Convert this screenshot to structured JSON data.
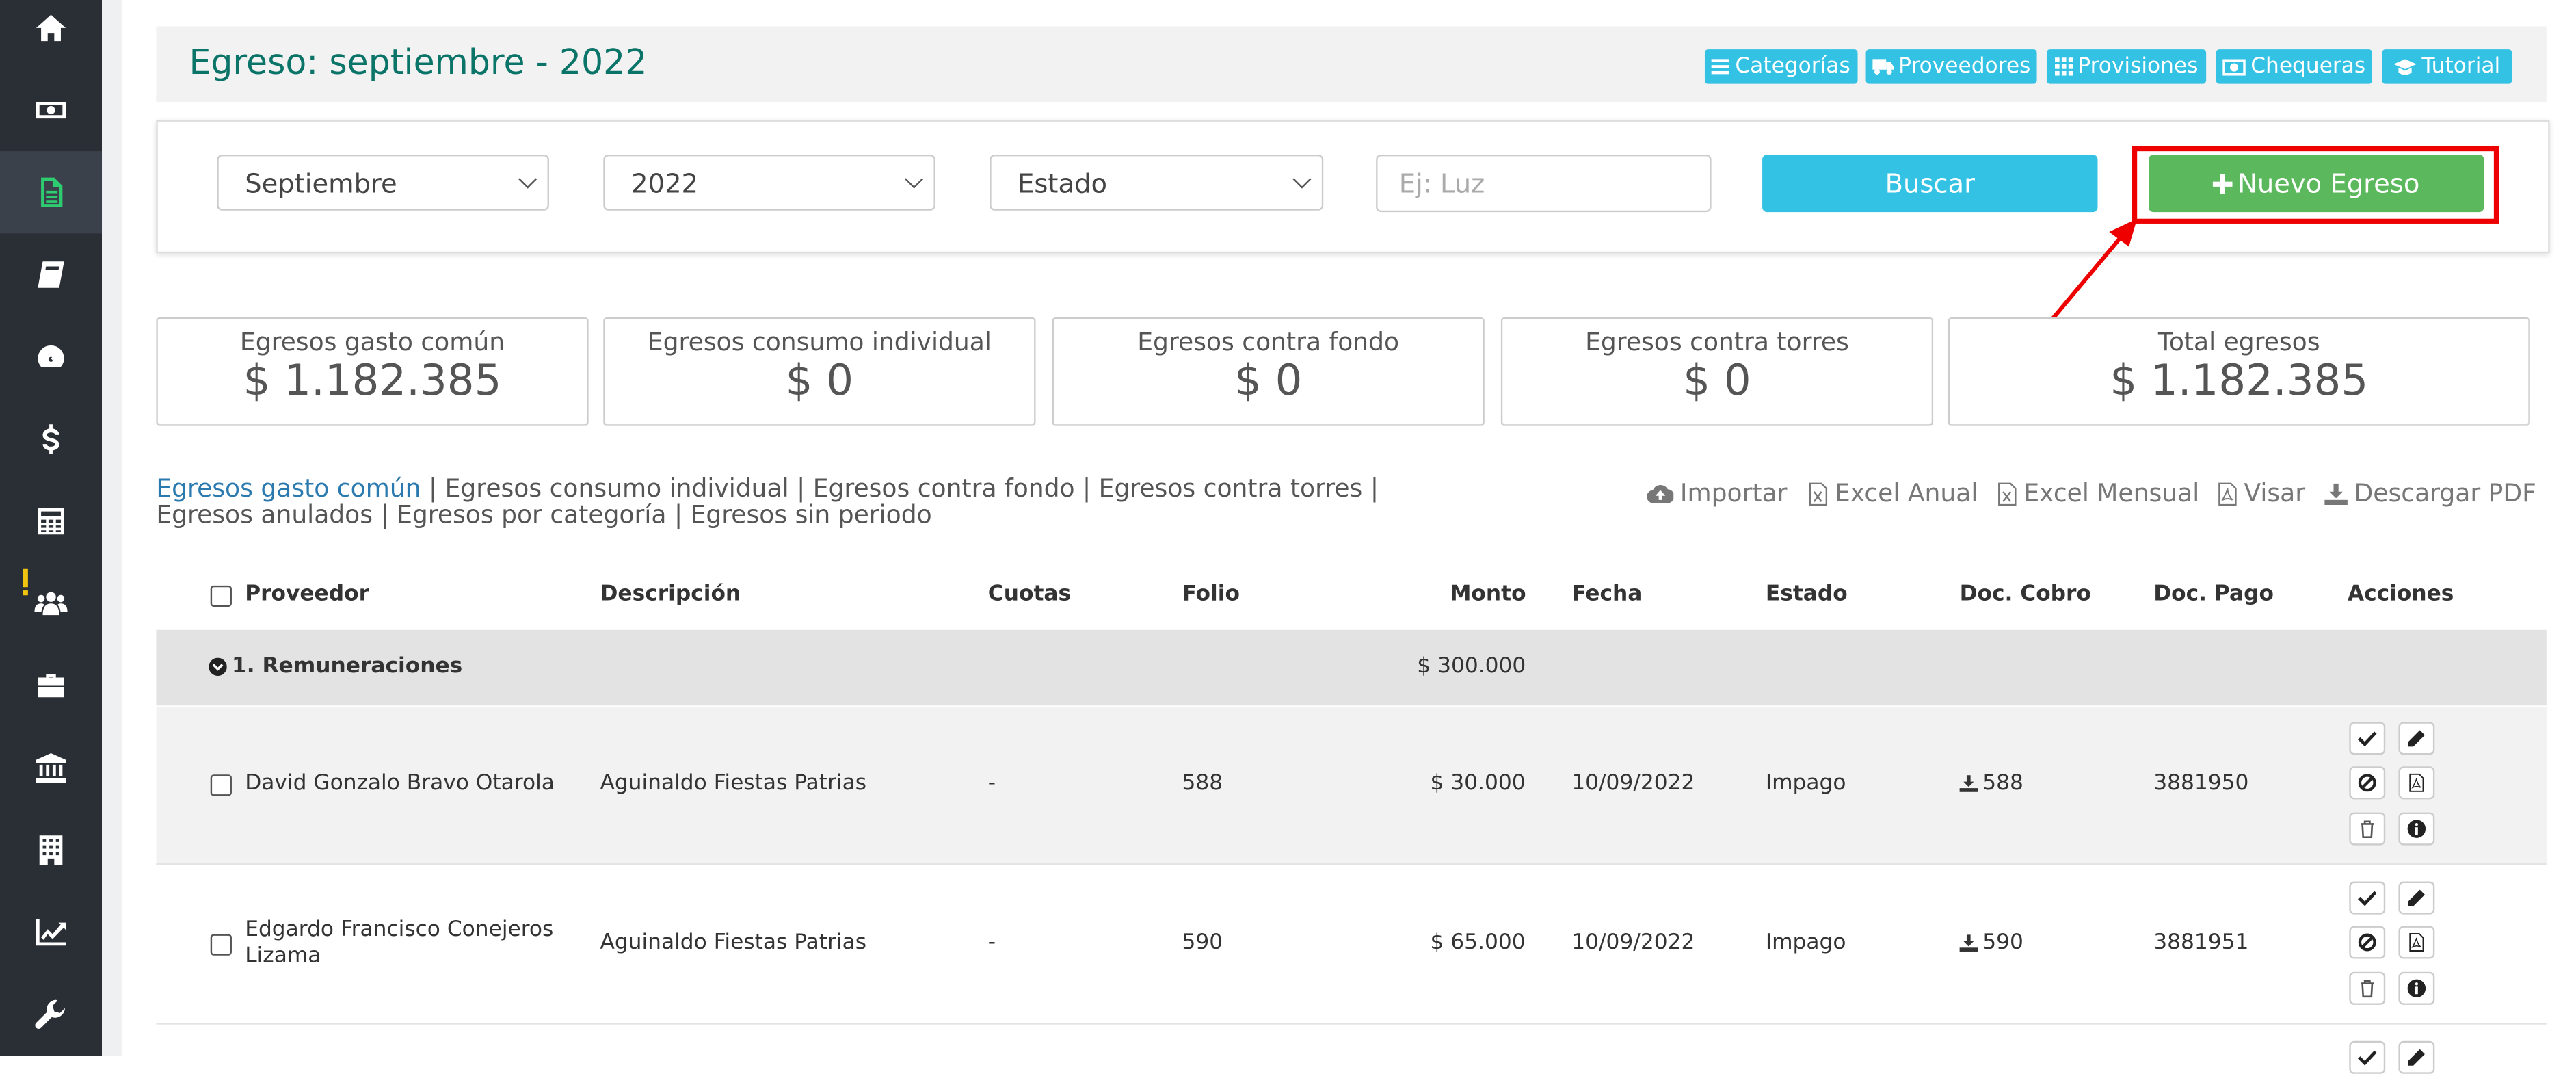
{
  "header": {
    "title": "Egreso: septiembre - 2022",
    "buttons": [
      {
        "label": "Categorías",
        "icon": "list-icon"
      },
      {
        "label": "Proveedores",
        "icon": "truck-icon"
      },
      {
        "label": "Provisiones",
        "icon": "grid-icon"
      },
      {
        "label": "Chequeras",
        "icon": "money-icon"
      },
      {
        "label": "Tutorial",
        "icon": "graduation-cap-icon"
      }
    ]
  },
  "sidebar": {
    "items": [
      "home-icon",
      "money-icon",
      "document-icon",
      "book-icon",
      "dashboard-icon",
      "dollar-icon",
      "calculator-icon",
      "users-icon",
      "briefcase-icon",
      "bank-icon",
      "building-icon",
      "chart-line-icon",
      "wrench-icon"
    ]
  },
  "filters": {
    "month": "Septiembre",
    "year": "2022",
    "status": "Estado",
    "search_placeholder": "Ej: Luz",
    "search_label": "Buscar",
    "new_label": "Nuevo Egreso"
  },
  "summary": [
    {
      "label": "Egresos gasto común",
      "value": "$ 1.182.385"
    },
    {
      "label": "Egresos consumo individual",
      "value": "$ 0"
    },
    {
      "label": "Egresos contra fondo",
      "value": "$ 0"
    },
    {
      "label": "Egresos contra torres",
      "value": "$ 0"
    },
    {
      "label": "Total egresos",
      "value": "$ 1.182.385"
    }
  ],
  "tabs": {
    "t1": "Egresos gasto común",
    "t2": "Egresos consumo individual",
    "t3": "Egresos contra fondo",
    "t4": "Egresos contra torres",
    "t5": "Egresos anulados",
    "t6": "Egresos por categoría",
    "t7": "Egresos sin periodo",
    "sep": " | "
  },
  "actions": {
    "importar": "Importar",
    "excel_anual": "Excel Anual",
    "excel_mensual": "Excel Mensual",
    "visar": "Visar",
    "descargar_pdf": "Descargar PDF"
  },
  "table": {
    "headers": {
      "proveedor": "Proveedor",
      "descripcion": "Descripción",
      "cuotas": "Cuotas",
      "folio": "Folio",
      "monto": "Monto",
      "fecha": "Fecha",
      "estado": "Estado",
      "doc_cobro": "Doc. Cobro",
      "doc_pago": "Doc. Pago",
      "acciones": "Acciones"
    },
    "group": {
      "name": "1. Remuneraciones",
      "total": "$ 300.000"
    },
    "rows": [
      {
        "proveedor": "David Gonzalo Bravo Otarola",
        "proveedor2": "",
        "descripcion": "Aguinaldo Fiestas Patrias",
        "cuotas": "-",
        "folio": "588",
        "monto": "$ 30.000",
        "fecha": "10/09/2022",
        "estado": "Impago",
        "doc_cobro": "588",
        "doc_pago": "3881950"
      },
      {
        "proveedor": "Edgardo Francisco Conejeros",
        "proveedor2": "Lizama",
        "descripcion": "Aguinaldo Fiestas Patrias",
        "cuotas": "-",
        "folio": "590",
        "monto": "$ 65.000",
        "fecha": "10/09/2022",
        "estado": "Impago",
        "doc_cobro": "590",
        "doc_pago": "3881951"
      }
    ]
  },
  "colors": {
    "accent": "#33c1e4",
    "success": "#5cb85c",
    "sidebar": "#2a2e35",
    "title": "#0b7468",
    "highlight": "#ee0000"
  }
}
